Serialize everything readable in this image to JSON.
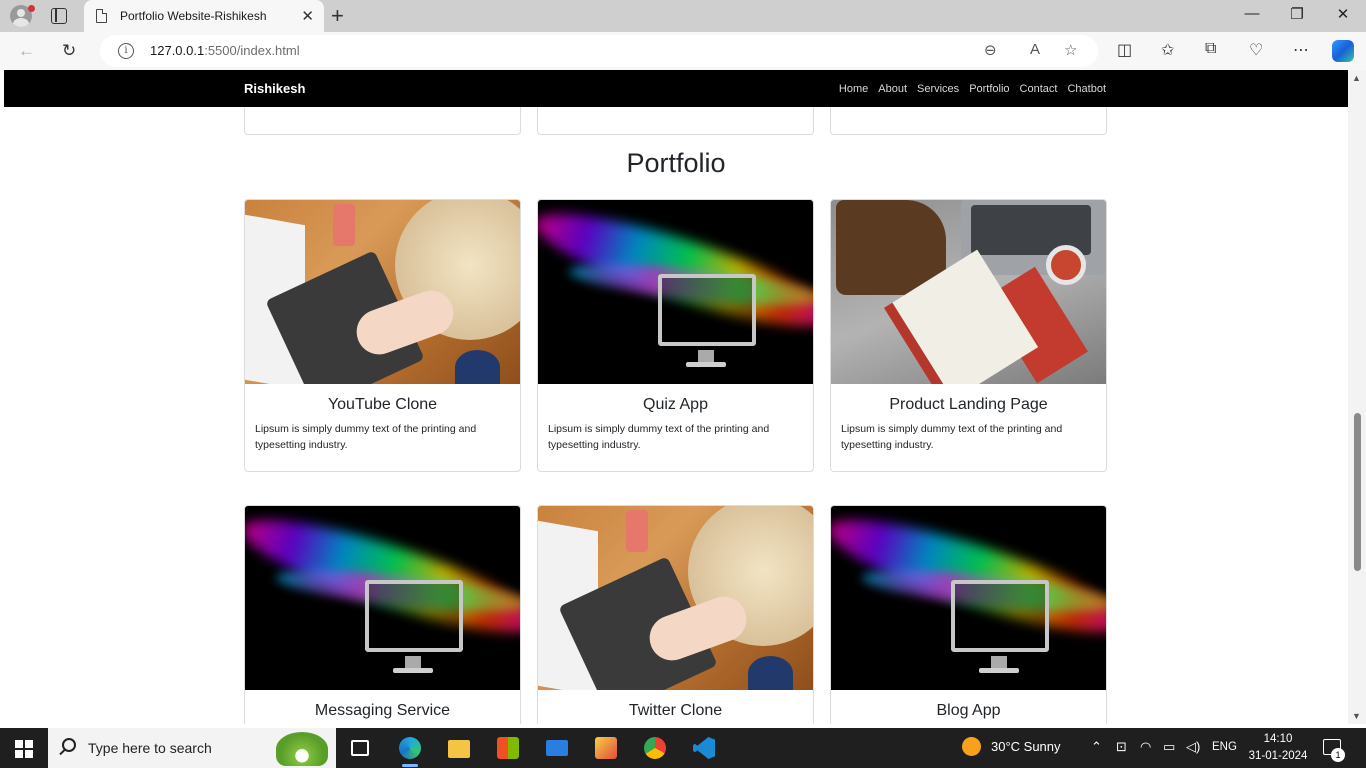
{
  "browser": {
    "tab_title": "Portfolio Website-Rishikesh",
    "url_host": "127.0.0.1",
    "url_rest": ":5500/index.html",
    "new_tab_label": "+"
  },
  "site": {
    "brand": "Rishikesh",
    "menu": [
      "Home",
      "About",
      "Services",
      "Portfolio",
      "Contact",
      "Chatbot"
    ],
    "section_title": "Portfolio",
    "cards": [
      {
        "title": "YouTube Clone",
        "text": "Lipsum is simply dummy text of the printing and typesetting industry.",
        "image": "laptop-photo"
      },
      {
        "title": "Quiz App",
        "text": "Lipsum is simply dummy text of the printing and typesetting industry.",
        "image": "smoke-monitor"
      },
      {
        "title": "Product Landing Page",
        "text": "Lipsum is simply dummy text of the printing and typesetting industry.",
        "image": "desk-notebook"
      },
      {
        "title": "Messaging Service",
        "image": "smoke-monitor"
      },
      {
        "title": "Twitter Clone",
        "image": "laptop-photo"
      },
      {
        "title": "Blog App",
        "image": "smoke-monitor"
      }
    ]
  },
  "taskbar": {
    "search_placeholder": "Type here to search",
    "weather": "30°C  Sunny",
    "language": "ENG",
    "time": "14:10",
    "date": "31-01-2024",
    "notification_count": "1"
  },
  "colors": {
    "nav_bg": "#000000",
    "accent": "#0078d4",
    "taskbar_bg": "#1f1f1f"
  }
}
